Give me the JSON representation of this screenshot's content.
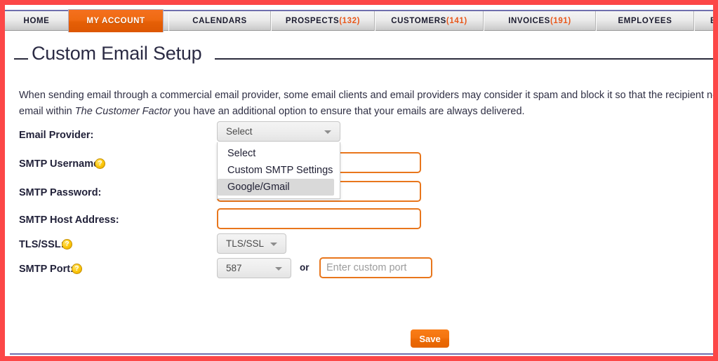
{
  "theme": {
    "frame_border_color": "#fc4747",
    "accent_orange": "#e8761c",
    "active_tab_color": "#ef6a12",
    "nav_rule_color": "#6f6fae",
    "help_icon_color": "#fcc70a",
    "count_badge_color": "#e8581c"
  },
  "nav": {
    "tabs": [
      {
        "label": "HOME",
        "count": "",
        "active": false
      },
      {
        "label": "MY ACCOUNT",
        "count": "",
        "active": true
      },
      {
        "label": "CALENDARS",
        "count": "",
        "active": false
      },
      {
        "label": "PROSPECTS",
        "count": "(132)",
        "active": false
      },
      {
        "label": "CUSTOMERS",
        "count": "(141)",
        "active": false
      },
      {
        "label": "INVOICES",
        "count": "(191)",
        "active": false
      },
      {
        "label": "EMPLOYEES",
        "count": "",
        "active": false
      },
      {
        "label": "BU",
        "count": "",
        "active": false
      }
    ]
  },
  "page": {
    "title": "Custom Email Setup",
    "intro_line_1": "When sending email through a commercial email provider, some email clients and email providers may consider it spam and block it so that the recipient never receive",
    "intro_line_2_prefix": "email within ",
    "intro_brand": "The Customer Factor",
    "intro_line_2_suffix": " you have an additional option to ensure that your emails are always delivered."
  },
  "form": {
    "email_provider": {
      "label": "Email Provider:",
      "value": "Select",
      "open": true,
      "options": [
        {
          "label": "Select",
          "highlighted": false
        },
        {
          "label": "Custom SMTP Settings",
          "highlighted": false
        },
        {
          "label": "Google/Gmail",
          "highlighted": true
        }
      ]
    },
    "smtp_username": {
      "label": "SMTP Username:",
      "has_help": true,
      "help_icon": "question-mark-icon",
      "value": "",
      "placeholder": ""
    },
    "smtp_password": {
      "label": "SMTP Password:",
      "has_help": false,
      "value": "",
      "placeholder": ""
    },
    "smtp_host": {
      "label": "SMTP Host Address:",
      "has_help": false,
      "value": "",
      "placeholder": ""
    },
    "tls_ssl": {
      "label": "TLS/SSL:",
      "has_help": true,
      "help_icon": "question-mark-icon",
      "value": "TLS/SSL"
    },
    "smtp_port": {
      "label": "SMTP Port:",
      "has_help": true,
      "help_icon": "question-mark-icon",
      "value": "587",
      "or_label": "or",
      "custom_port_value": "",
      "custom_port_placeholder": "Enter custom port"
    },
    "save_label": "Save"
  }
}
